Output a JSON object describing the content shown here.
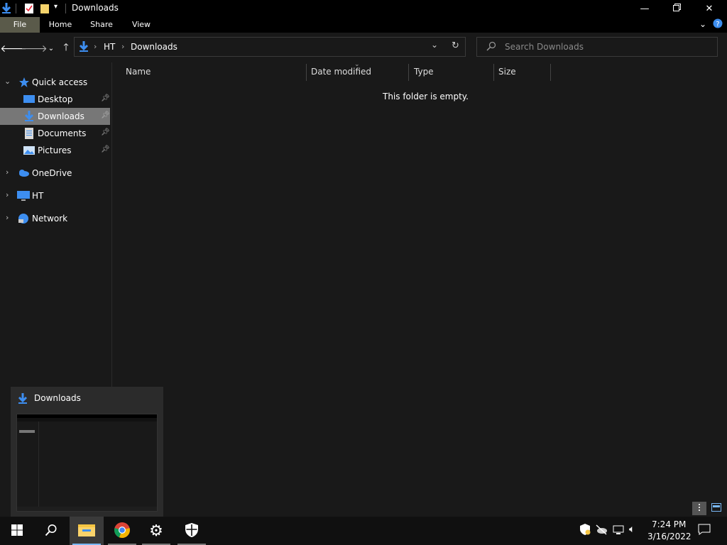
{
  "window": {
    "title": "Downloads"
  },
  "ribbon": {
    "tabs": [
      "File",
      "Home",
      "Share",
      "View"
    ]
  },
  "address": {
    "crumbs": [
      "HT",
      "Downloads"
    ]
  },
  "search": {
    "placeholder": "Search Downloads"
  },
  "nav_pane": {
    "quick_access": "Quick access",
    "items": [
      {
        "label": "Desktop",
        "icon": "desktop-icon",
        "pinned": true
      },
      {
        "label": "Downloads",
        "icon": "downloads-icon",
        "pinned": true,
        "selected": true
      },
      {
        "label": "Documents",
        "icon": "documents-icon",
        "pinned": true
      },
      {
        "label": "Pictures",
        "icon": "pictures-icon",
        "pinned": true
      }
    ],
    "onedrive": "OneDrive",
    "pc": "HT",
    "network": "Network"
  },
  "columns": [
    "Name",
    "Date modified",
    "Type",
    "Size"
  ],
  "content": {
    "empty_message": "This folder is empty."
  },
  "thumbnail": {
    "title": "Downloads"
  },
  "taskbar": {
    "time": "7:24 PM",
    "date": "3/16/2022"
  },
  "colors": {
    "accent": "#1e90ff",
    "selected_bg": "#777777",
    "window_bg": "#191919"
  }
}
